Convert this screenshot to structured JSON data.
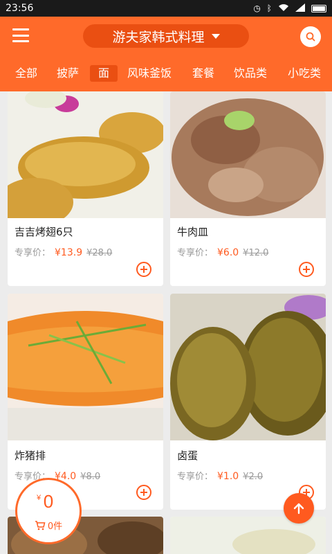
{
  "status_bar": {
    "time": "23:56"
  },
  "header": {
    "store_name": "游夫家韩式料理"
  },
  "tabs": [
    {
      "label": "全部"
    },
    {
      "label": "披萨"
    },
    {
      "label": "面"
    },
    {
      "label": "风味釜饭"
    },
    {
      "label": "套餐"
    },
    {
      "label": "饮品类"
    },
    {
      "label": "小吃类"
    }
  ],
  "products": [
    {
      "name": "吉吉烤翅6只",
      "price_label": "专享价：",
      "price": "¥13.9",
      "original_price": "¥28.0"
    },
    {
      "name": "牛肉皿",
      "price_label": "专享价：",
      "price": "¥6.0",
      "original_price": "¥12.0"
    },
    {
      "name": "炸猪排",
      "price_label": "专享价：",
      "price": "¥4.0",
      "original_price": "¥8.0"
    },
    {
      "name": "卤蛋",
      "price_label": "专享价：",
      "price": "¥1.0",
      "original_price": "¥2.0"
    }
  ],
  "cart": {
    "currency": "¥",
    "amount": "0",
    "count": "0件"
  },
  "colors": {
    "accent": "#ff6a2a",
    "accent_dark": "#ea4f12",
    "price": "#ff5a1f"
  }
}
